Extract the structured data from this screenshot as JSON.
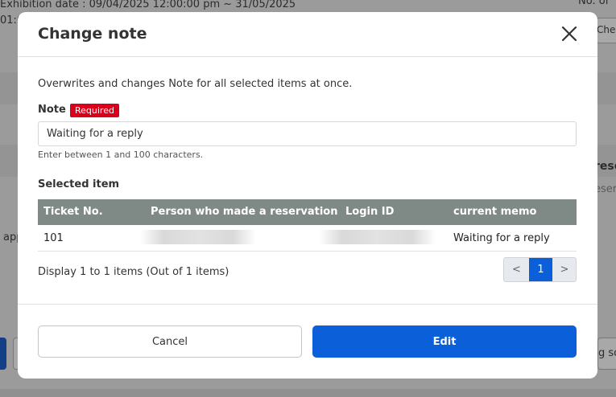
{
  "background": {
    "exhibition_line": "Exhibition date : 09/04/2025 12:00:00 pm ~ 31/05/2025",
    "time_fragment": "01:0",
    "right_top_fragment": "No. of",
    "right_button_fragment": "Chec",
    "right_heading_fragment": "rese",
    "right_sub_fragment": "eser",
    "left_fragment": "app",
    "right_bottom_button_fragment": "g sc"
  },
  "modal": {
    "title": "Change note",
    "close_icon": "close-icon",
    "description": "Overwrites and changes Note for all selected items at once.",
    "note_label": "Note",
    "required_badge": "Required",
    "note_value": "Waiting for a reply",
    "note_hint": "Enter between 1 and 100 characters.",
    "selected_label": "Selected item",
    "table": {
      "columns": [
        "Ticket No.",
        "Person who made a reservation",
        "Login ID",
        "current memo"
      ],
      "rows": [
        {
          "ticket_no": "101",
          "person": "",
          "login_id": "",
          "current_memo": "Waiting for a reply"
        }
      ]
    },
    "display_text": "Display 1 to 1 items (Out of 1 items)",
    "pagination": {
      "prev": "<",
      "current": "1",
      "next": ">"
    },
    "cancel_label": "Cancel",
    "edit_label": "Edit"
  },
  "colors": {
    "primary": "#0b5fd9",
    "required": "#d9001b",
    "table_header": "#7f8a86"
  }
}
